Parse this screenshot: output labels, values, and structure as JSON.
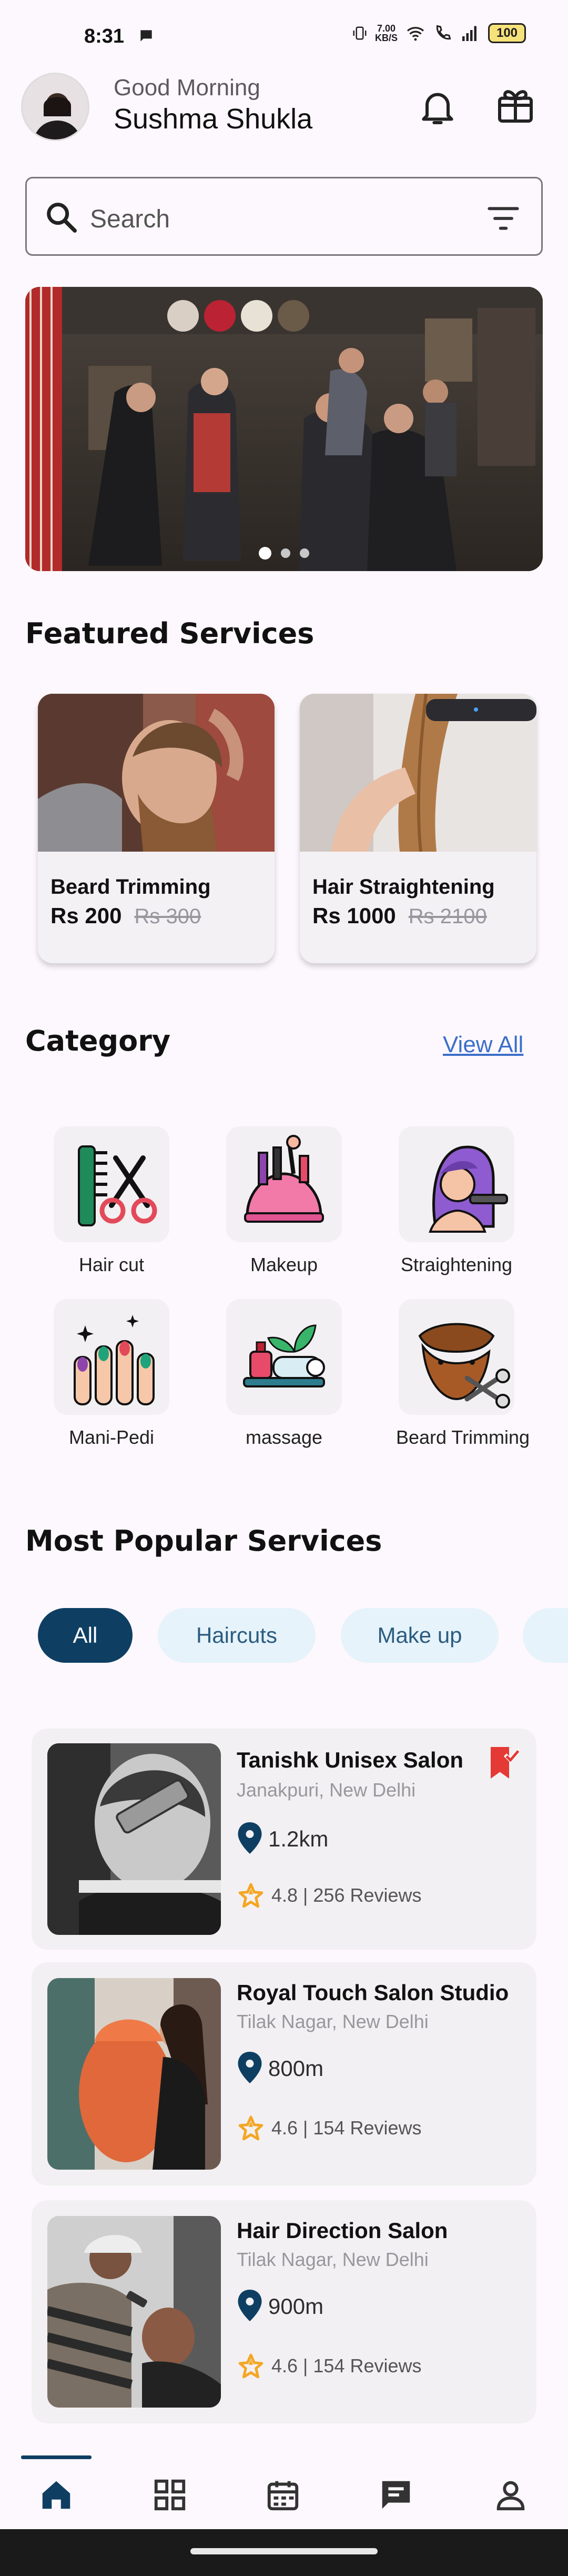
{
  "status": {
    "time": "8:31",
    "net_speed_top": "7.00",
    "net_speed_bottom": "KB/S",
    "battery": "100"
  },
  "header": {
    "greeting": "Good Morning",
    "user_name": "Sushma Shukla"
  },
  "search": {
    "placeholder": "Search"
  },
  "banner": {
    "slides": 3,
    "active_slide": 1
  },
  "featured": {
    "title": "Featured Services",
    "items": [
      {
        "name": "Beard Trimming",
        "price": "Rs 200",
        "old_price": "Rs 300"
      },
      {
        "name": "Hair Straightening",
        "price": "Rs 1000",
        "old_price": "Rs 2100"
      }
    ]
  },
  "category": {
    "title": "Category",
    "view_all": "View All",
    "items": [
      {
        "label": "Hair cut",
        "icon": "comb-scissors-icon"
      },
      {
        "label": "Makeup",
        "icon": "makeup-kit-icon"
      },
      {
        "label": "Straightening",
        "icon": "hair-straightener-icon"
      },
      {
        "label": "Mani-Pedi",
        "icon": "nail-polish-icon"
      },
      {
        "label": "massage",
        "icon": "spa-massage-icon"
      },
      {
        "label": "Beard Trimming",
        "icon": "beard-scissors-icon"
      }
    ]
  },
  "popular": {
    "title": "Most Popular Services",
    "filters": [
      "All",
      "Haircuts",
      "Make up"
    ],
    "active_filter": "All",
    "salons": [
      {
        "name": "Tanishk Unisex Salon",
        "location": "Janakpuri, New Delhi",
        "distance": "1.2km",
        "rating": "4.8 | 256 Reviews",
        "bookmarked": true
      },
      {
        "name": "Royal Touch Salon Studio",
        "location": "Tilak Nagar, New Delhi",
        "distance": "800m",
        "rating": "4.6 | 154 Reviews",
        "bookmarked": false
      },
      {
        "name": "Hair Direction Salon",
        "location": "Tilak Nagar, New Delhi",
        "distance": "900m",
        "rating": "4.6 | 154 Reviews",
        "bookmarked": false
      }
    ]
  },
  "colors": {
    "primary": "#0e3f63",
    "chip_bg": "#e6f3fa",
    "link": "#3b6fc9",
    "star": "#f4a623",
    "bookmark": "#e53935"
  },
  "nav": {
    "items": [
      "home-icon",
      "grid-icon",
      "calendar-icon",
      "chat-icon",
      "profile-icon"
    ],
    "active": "home-icon"
  }
}
